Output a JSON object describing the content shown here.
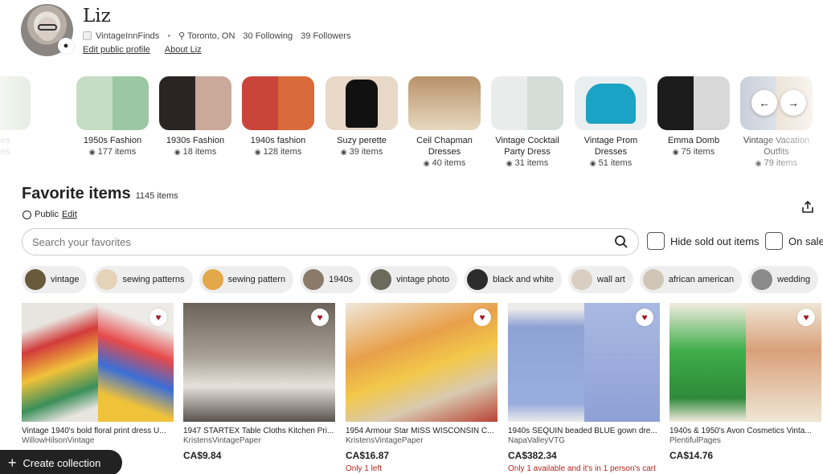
{
  "profile": {
    "name": "Liz",
    "shop": "VintageInnFinds",
    "location": "Toronto, ON",
    "following": "30 Following",
    "followers": "39 Followers",
    "edit_profile": "Edit public profile",
    "about": "About Liz"
  },
  "collections": [
    {
      "title": "earches",
      "title2": "earches",
      "count": ""
    },
    {
      "title": "1950s Fashion",
      "title2": "",
      "count": "177 items"
    },
    {
      "title": "1930s Fashion",
      "title2": "",
      "count": "18 items"
    },
    {
      "title": "1940s fashion",
      "title2": "",
      "count": "128 items"
    },
    {
      "title": "Suzy perette",
      "title2": "",
      "count": "39 items"
    },
    {
      "title": "Ceil Chapman",
      "title2": "Dresses",
      "count": "40 items"
    },
    {
      "title": "Vintage Cocktail",
      "title2": "Party Dress",
      "count": "31 items"
    },
    {
      "title": "Vintage Prom",
      "title2": "Dresses",
      "count": "51 items"
    },
    {
      "title": "Emma Domb",
      "title2": "",
      "count": "75 items"
    },
    {
      "title": "Vintage Vacation",
      "title2": "Outfits",
      "count": "79 items"
    }
  ],
  "favorites": {
    "title": "Favorite items",
    "count": "1145 items",
    "privacy": "Public",
    "edit": "Edit"
  },
  "search": {
    "placeholder": "Search your favorites"
  },
  "filters": {
    "hide_sold": "Hide sold out items",
    "on_sale": "On sale"
  },
  "tags": [
    {
      "label": "vintage"
    },
    {
      "label": "sewing patterns"
    },
    {
      "label": "sewing pattern"
    },
    {
      "label": "1940s"
    },
    {
      "label": "vintage photo"
    },
    {
      "label": "black and white"
    },
    {
      "label": "wall art"
    },
    {
      "label": "african american"
    },
    {
      "label": "wedding"
    }
  ],
  "items": [
    {
      "title": "Vintage 1940's bold floral print dress U...",
      "shop": "WillowHilsonVintage",
      "price": "",
      "note": ""
    },
    {
      "title": "1947 STARTEX Table Cloths Kitchen Pri...",
      "shop": "KristensVintagePaper",
      "price": "CA$9.84",
      "note": ""
    },
    {
      "title": "1954 Armour Star MISS WISCONSIN C...",
      "shop": "KristensVintagePaper",
      "price": "CA$16.87",
      "note": "Only 1 left"
    },
    {
      "title": "1940s SEQUIN beaded BLUE gown dre...",
      "shop": "NapaValleyVTG",
      "price": "CA$382.34",
      "note": "Only 1 available and it's in 1 person's cart"
    },
    {
      "title": "1940s & 1950's Avon Cosmetics Vinta...",
      "shop": "PlentifulPages",
      "price": "CA$14.76",
      "note": ""
    }
  ],
  "create_collection": "Create collection",
  "colors": {
    "heart": "#a61a2e",
    "warning": "#b3261e"
  }
}
